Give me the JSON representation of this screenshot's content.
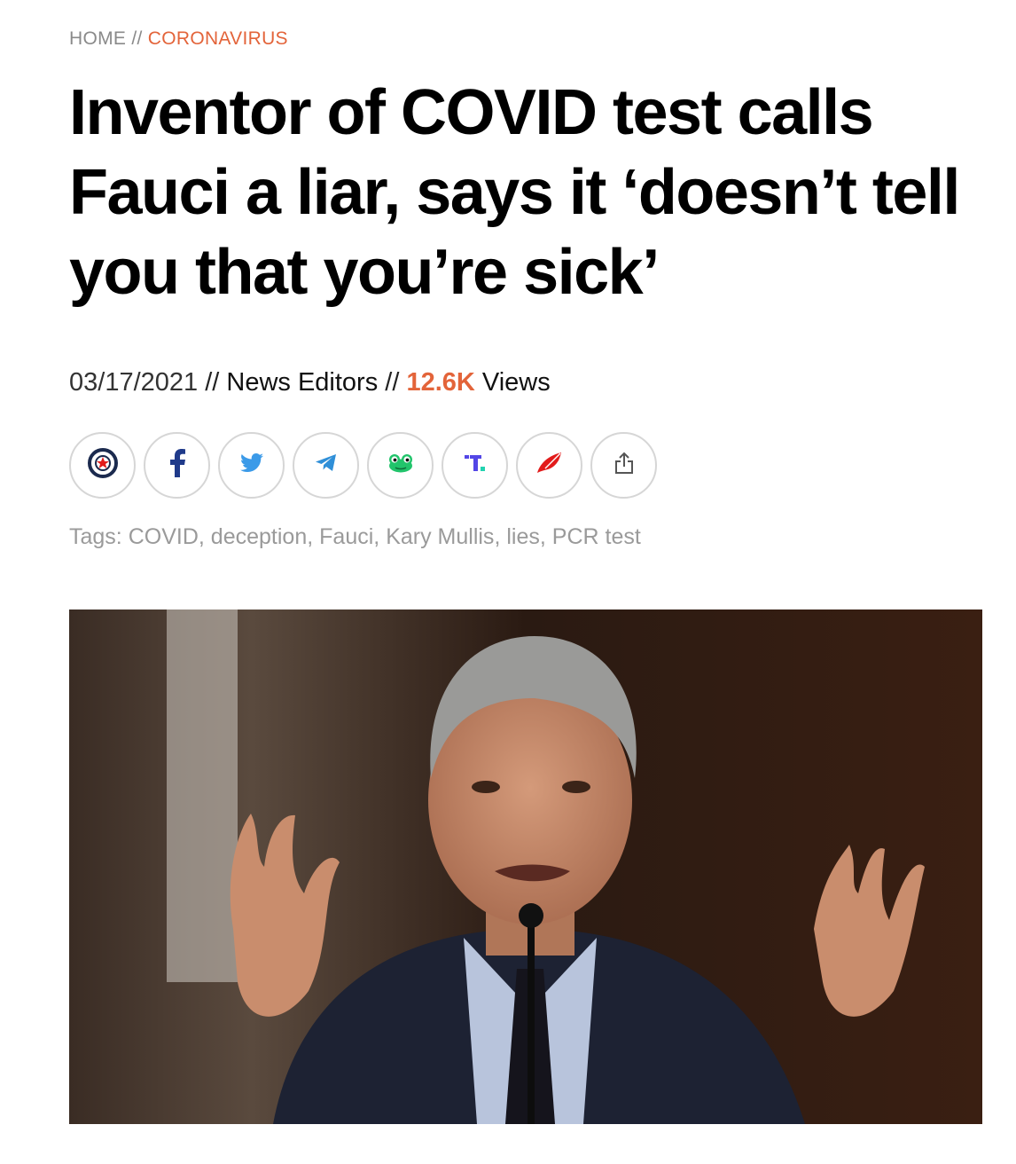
{
  "breadcrumb": {
    "home": "HOME",
    "separator": " // ",
    "category": "CORONAVIRUS"
  },
  "article": {
    "title": "Inventor of COVID test calls Fauci a liar, says it ‘doesn’t tell you that you’re sick’",
    "date": "03/17/2021",
    "separator": " // ",
    "author": "News Editors",
    "views_count": "12.6K",
    "views_label": " Views"
  },
  "share_buttons": [
    {
      "icon": "circle-star-icon"
    },
    {
      "icon": "facebook-icon"
    },
    {
      "icon": "twitter-icon"
    },
    {
      "icon": "telegram-icon"
    },
    {
      "icon": "gab-frog-icon"
    },
    {
      "icon": "truth-social-icon"
    },
    {
      "icon": "gettr-icon"
    },
    {
      "icon": "share-icon"
    }
  ],
  "tags": {
    "label": "Tags: ",
    "items": [
      "COVID",
      "deception",
      "Fauci",
      "Kary Mullis",
      "lies",
      "PCR test"
    ]
  },
  "colors": {
    "accent": "#e3643a",
    "facebook": "#1f3a8a",
    "twitter": "#3b9ae8",
    "telegram": "#2f8fd8",
    "gab": "#21c46b",
    "gettr": "#e21b1b"
  }
}
